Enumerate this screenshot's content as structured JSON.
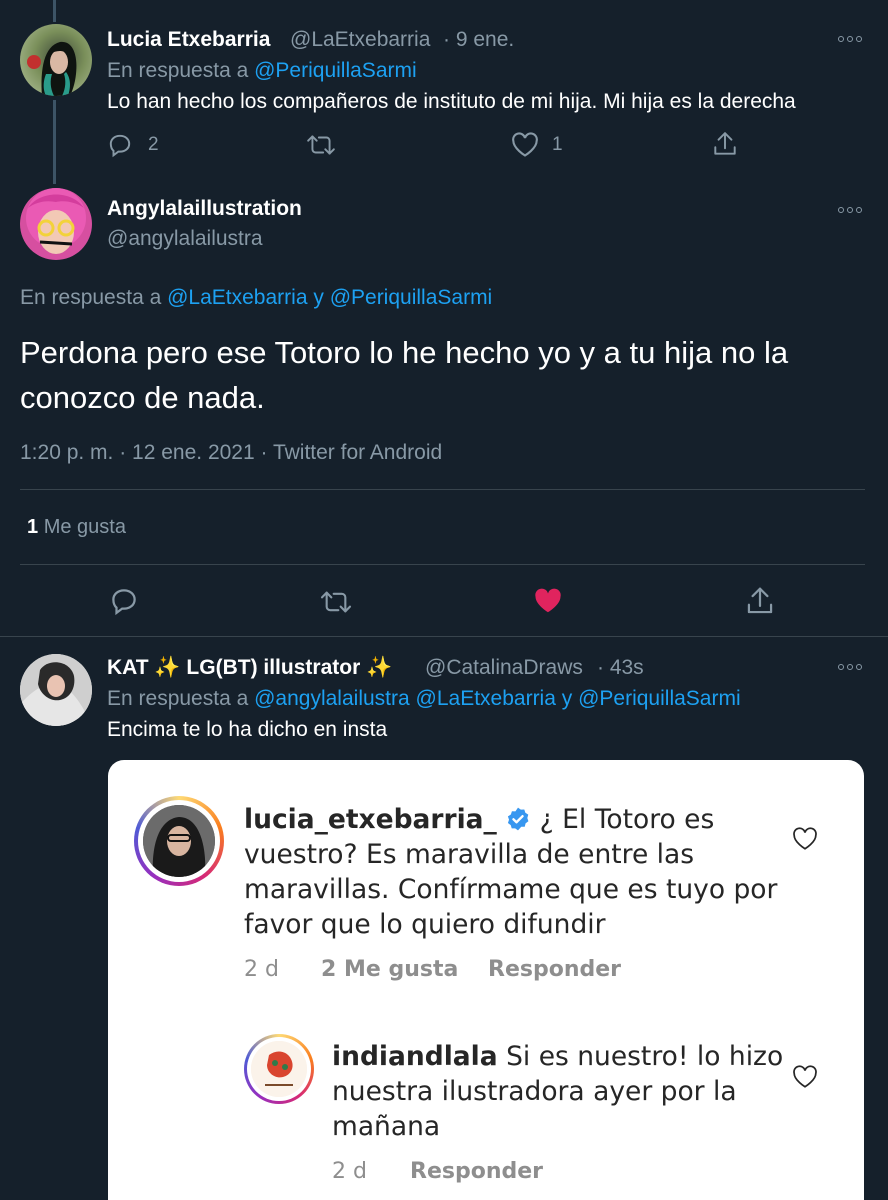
{
  "tweet1": {
    "name": "Lucia Etxebarria",
    "handle": "@LaEtxebarria",
    "time": "· 9 ene.",
    "reply_prefix": "En respuesta a",
    "reply_to": "@PeriquillaSarmi",
    "text": "Lo han hecho los compañeros de instituto de mi hija. Mi hija es la derecha",
    "reply_count": "2",
    "like_count": "1"
  },
  "main_tweet": {
    "name": "Angylalaillustration",
    "handle": "@angylalailustra",
    "reply_prefix": "En respuesta a",
    "reply_to_1": "@LaEtxebarria",
    "reply_conj": "y",
    "reply_to_2": "@PeriquillaSarmi",
    "text": "Perdona pero ese Totoro lo he hecho yo y a tu hija no la conozco de nada.",
    "meta": "1:20 p. m. · 12 ene. 2021 · Twitter for Android",
    "likes_num": "1",
    "likes_label": "Me gusta",
    "liked_color": "#e0245e"
  },
  "tweet3": {
    "name": "KAT ✨ LG(BT) illustrator ✨",
    "handle": "@CatalinaDraws",
    "time": "· 43s",
    "reply_prefix": "En respuesta a",
    "reply_to_1": "@angylalailustra",
    "reply_to_2": "@LaEtxebarria",
    "reply_conj": "y",
    "reply_to_3": "@PeriquillaSarmi",
    "text": "Encima te lo ha dicho en insta"
  },
  "instagram": {
    "comment1": {
      "username": "lucia_etxebarria_",
      "line1": "¿ El Totoro es",
      "line2": "vuestro? Es maravilla de entre las",
      "line3": "maravillas. Confírmame que es tuyo por",
      "line4": "favor que lo quiero difundir",
      "time": "2 d",
      "likes": "2 Me gusta",
      "reply": "Responder"
    },
    "comment2": {
      "username": "indiandlala",
      "line1": "Si es nuestro! lo hizo",
      "line2": "nuestra ilustradora ayer por la",
      "line3": "mañana",
      "time": "2 d",
      "reply": "Responder"
    }
  },
  "colors": {
    "background": "#15202b",
    "link": "#1da1f2",
    "muted": "#8899a6",
    "verified": "#3897f0"
  }
}
